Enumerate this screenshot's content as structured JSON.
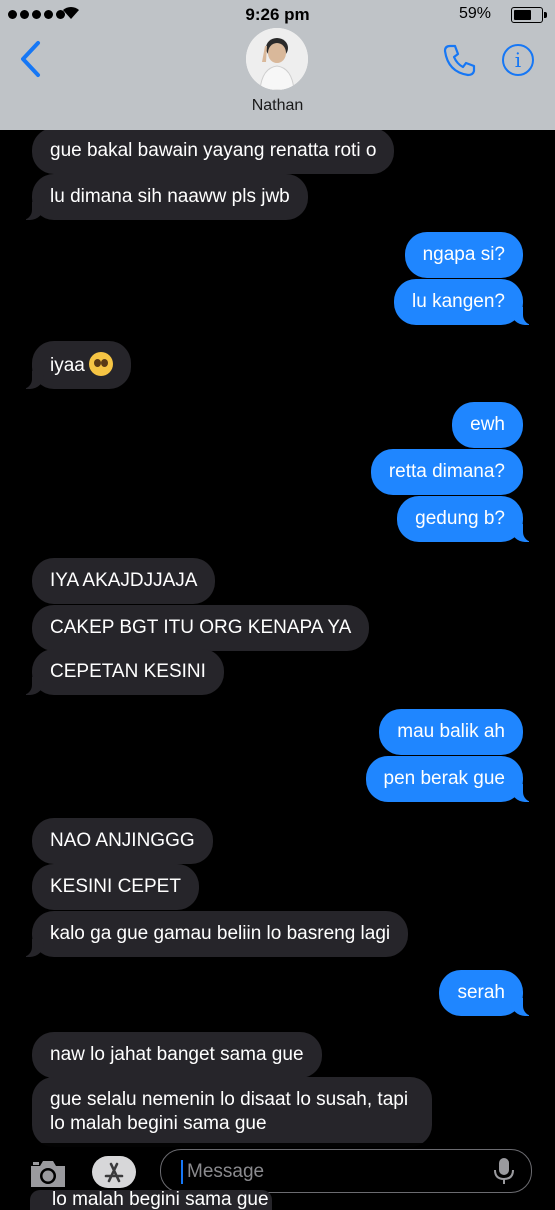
{
  "status_bar": {
    "time": "9:26 pm",
    "battery": "59%"
  },
  "header": {
    "contact_name": "Nathan",
    "accent_color": "#1677f5"
  },
  "messages": [
    {
      "side": "in",
      "text": "gue bakal bawain yayang renatta roti o"
    },
    {
      "side": "in",
      "text": "lu dimana sih naaww pls jwb"
    },
    {
      "side": "out",
      "text": "ngapa si?"
    },
    {
      "side": "out",
      "text": "lu kangen?"
    },
    {
      "side": "in",
      "text": "iyaa",
      "emoji": "pleading-face"
    },
    {
      "side": "out",
      "text": "ewh"
    },
    {
      "side": "out",
      "text": "retta dimana?"
    },
    {
      "side": "out",
      "text": "gedung b?"
    },
    {
      "side": "in",
      "text": "IYA AKAJDJJAJA"
    },
    {
      "side": "in",
      "text": "CAKEP BGT ITU ORG KENAPA YA"
    },
    {
      "side": "in",
      "text": "CEPETAN KESINI"
    },
    {
      "side": "out",
      "text": "mau balik ah"
    },
    {
      "side": "out",
      "text": "pen berak gue"
    },
    {
      "side": "in",
      "text": "NAO ANJINGGG"
    },
    {
      "side": "in",
      "text": "KESINI CEPET"
    },
    {
      "side": "in",
      "text": "kalo ga gue gamau beliin lo basreng lagi"
    },
    {
      "side": "out",
      "text": "serah"
    },
    {
      "side": "in",
      "text": "naw lo jahat banget sama gue"
    },
    {
      "side": "in",
      "text": "gue selalu nemenin lo disaat lo susah, tapi lo malah begini sama gue"
    }
  ],
  "peek_text": "lo malah begini sama gue",
  "composer": {
    "placeholder": "Message"
  },
  "colors": {
    "incoming_bubble": "#26252a",
    "outgoing_bubble": "#1f86ff",
    "background": "#000000"
  }
}
